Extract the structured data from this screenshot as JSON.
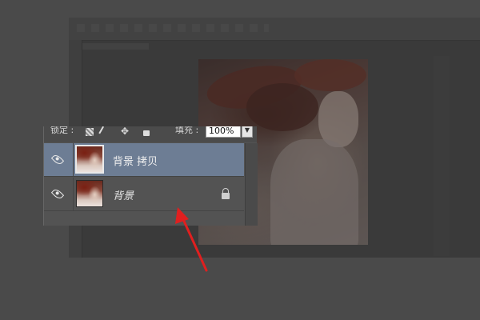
{
  "panel": {
    "lock_label": "锁定 :",
    "fill_label": "填充 :",
    "fill_value": "100%",
    "fill_dropdown_glyph": "▼"
  },
  "layers": [
    {
      "name": "背景 拷贝",
      "selected": true,
      "locked": false
    },
    {
      "name": "背景",
      "selected": false,
      "locked": true
    }
  ],
  "icons": {
    "visibility": "eye-icon",
    "lock": "lock-icon",
    "move": "✥"
  },
  "colors": {
    "selected_row": "#6d7d94",
    "panel_bg": "#535353",
    "annotation_arrow": "#e01f1f"
  }
}
